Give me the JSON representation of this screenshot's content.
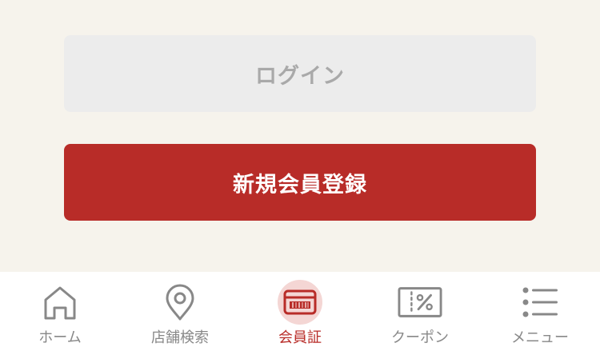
{
  "auth": {
    "login_label": "ログイン",
    "register_label": "新規会員登録"
  },
  "tabbar": {
    "active_index": 2,
    "items": [
      {
        "label": "ホーム",
        "icon": "home-icon"
      },
      {
        "label": "店舗検索",
        "icon": "map-pin-icon"
      },
      {
        "label": "会員証",
        "icon": "member-card-icon"
      },
      {
        "label": "クーポン",
        "icon": "coupon-icon"
      },
      {
        "label": "メニュー",
        "icon": "menu-list-icon"
      }
    ]
  },
  "colors": {
    "background": "#f6f3ec",
    "accent": "#b82c28",
    "accent_soft": "#f4d6d4",
    "inactive": "#888888",
    "login_bg": "#ececec",
    "login_text": "#a9a9a9"
  }
}
